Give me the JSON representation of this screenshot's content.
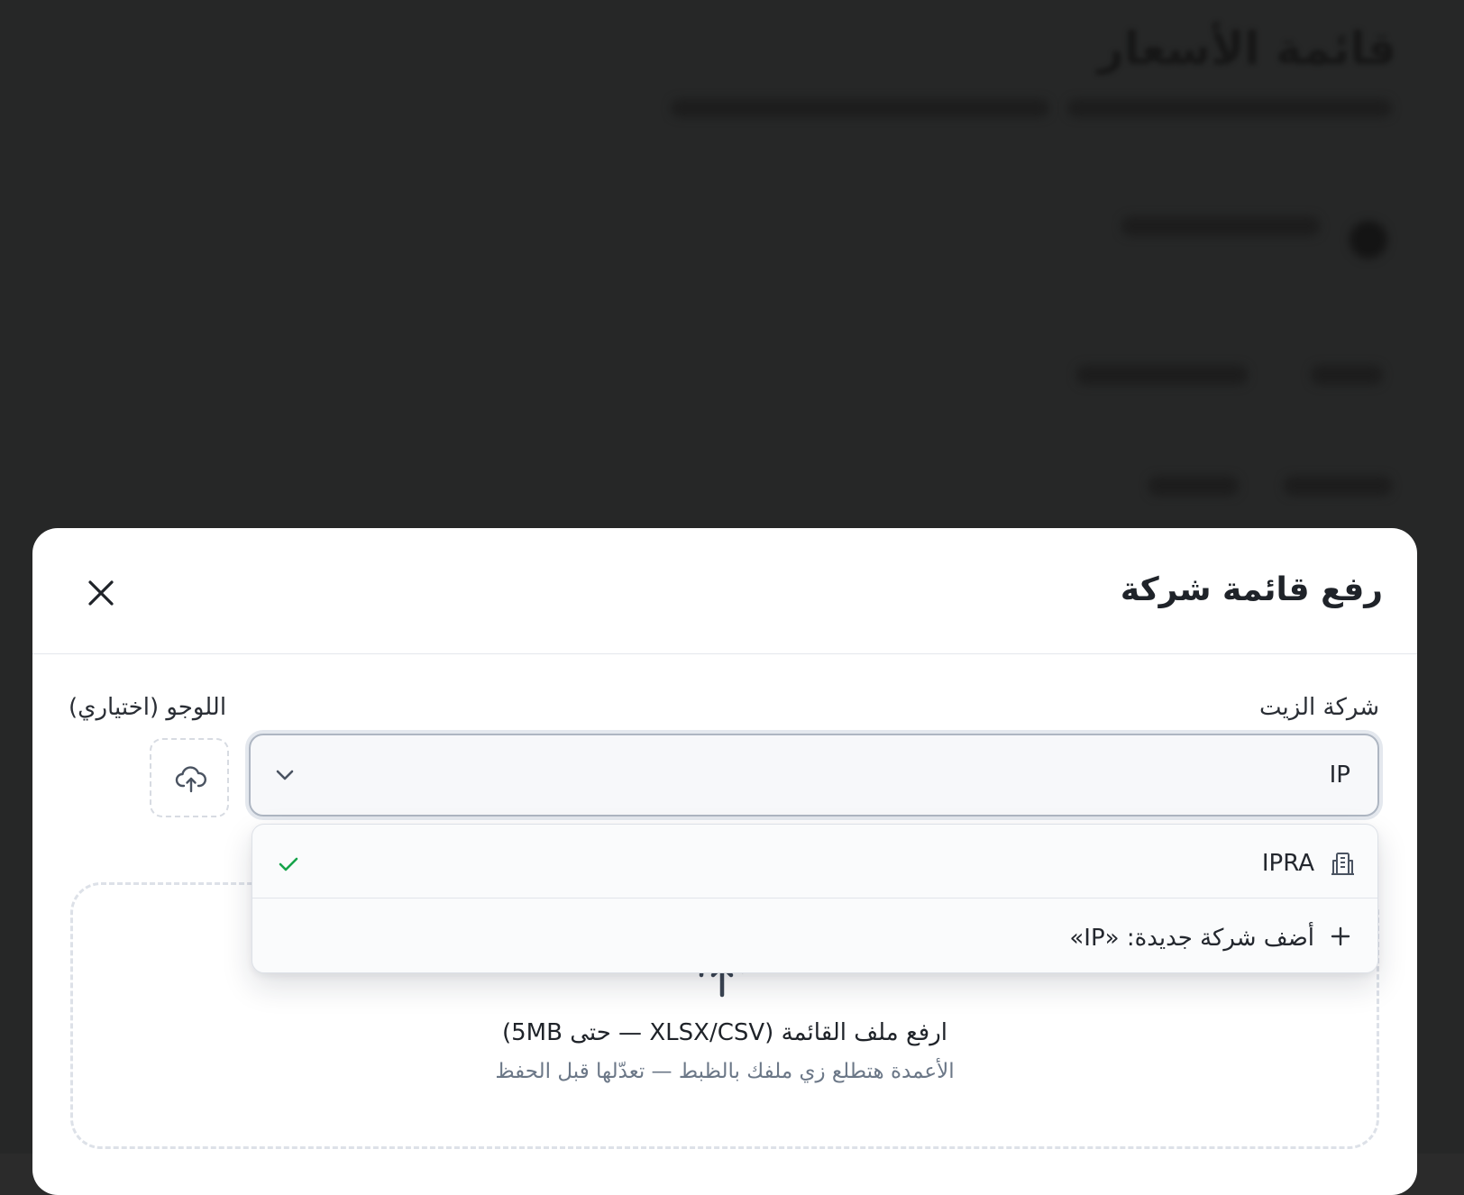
{
  "background": {
    "heading": "قائمة الأسعار"
  },
  "modal": {
    "title": "رفع قائمة شركة",
    "company_field": {
      "label": "شركة الزيت",
      "value": "IP"
    },
    "logo_field": {
      "label": "اللوجو (اختياري)",
      "icon": "cloud-upload-icon"
    },
    "dropdown": {
      "options": [
        {
          "label": "IPRA",
          "icon": "building-icon",
          "selected": true
        },
        {
          "label": "أضف شركة جديدة: «IP»",
          "icon": "plus-icon"
        }
      ]
    },
    "dropzone": {
      "title": "ارفع ملف القائمة (XLSX/CSV — حتى 5MB)",
      "subtitle": "الأعمدة هتطلع زي ملفك بالظبط — تعدّلها قبل الحفظ",
      "icon": "upload-icon"
    }
  },
  "colors": {
    "check": "#16a34a",
    "border_focus": "#aeb6c2",
    "muted_text": "#6b7787"
  }
}
